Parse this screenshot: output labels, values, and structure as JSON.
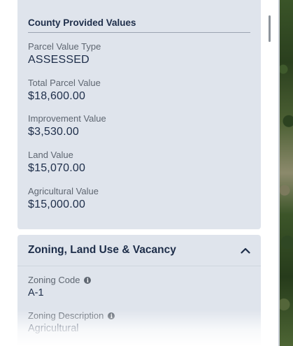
{
  "county": {
    "title": "County Provided Values",
    "fields": [
      {
        "label": "Parcel Value Type",
        "value": "ASSESSED"
      },
      {
        "label": "Total Parcel Value",
        "value": "$18,600.00"
      },
      {
        "label": "Improvement Value",
        "value": "$3,530.00"
      },
      {
        "label": "Land Value",
        "value": "$15,070.00"
      },
      {
        "label": "Agricultural Value",
        "value": "$15,000.00"
      }
    ]
  },
  "zoning": {
    "title": "Zoning, Land Use & Vacancy",
    "collapse_icon": "chevron-up-icon",
    "fields": [
      {
        "label": "Zoning Code",
        "value": "A-1",
        "info_icon": "info-icon"
      },
      {
        "label": "Zoning Description",
        "value": "Agricultural",
        "info_icon": "info-icon"
      }
    ]
  },
  "colors": {
    "card_bg": "#dfe4ec",
    "heading": "#1d2d49",
    "label": "#5e6671"
  }
}
